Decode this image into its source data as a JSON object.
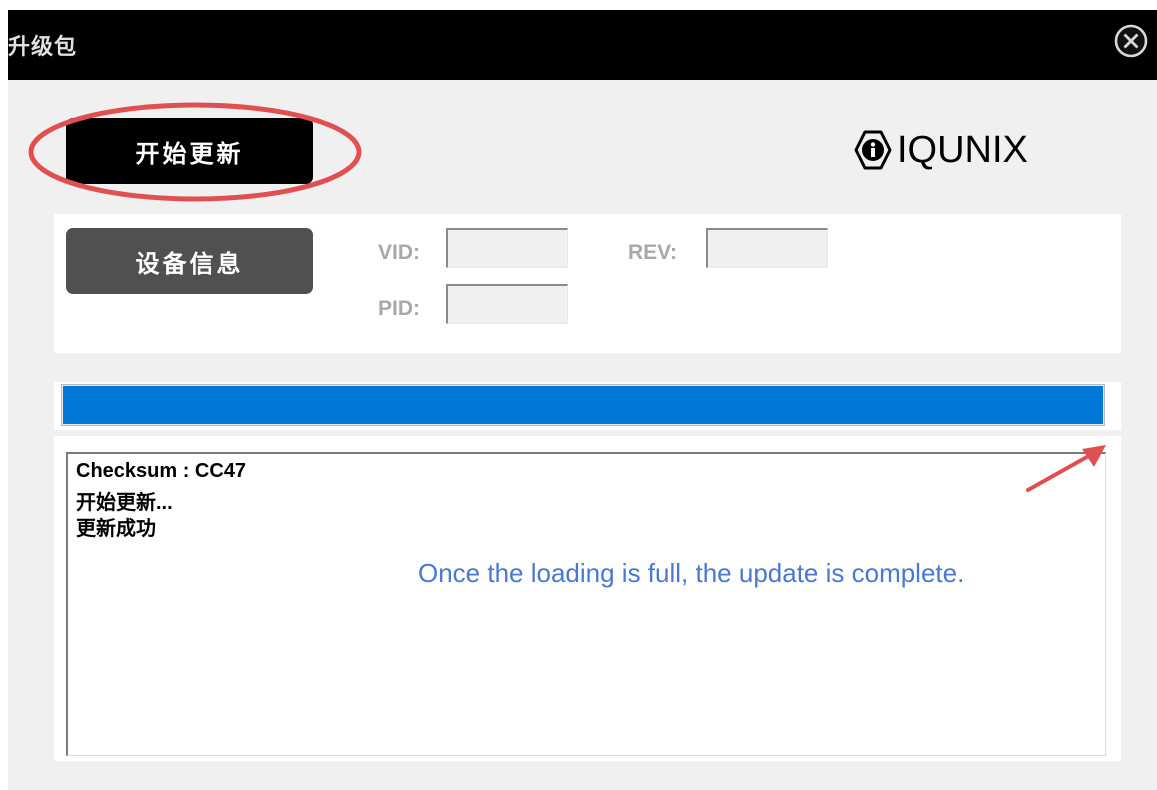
{
  "window": {
    "title": "升级包",
    "close_icon": "close-circle-icon"
  },
  "actions": {
    "start_update_label": "开始更新",
    "device_info_label": "设备信息"
  },
  "brand": {
    "logo_icon": "info-circle-logo-icon",
    "logo_text": "IQUNIX"
  },
  "device_fields": {
    "vid_label": "VID:",
    "vid_value": "",
    "pid_label": "PID:",
    "pid_value": "",
    "rev_label": "REV:",
    "rev_value": ""
  },
  "progress": {
    "fraction": 1.0,
    "color": "#0078d7"
  },
  "log": {
    "lines": [
      "Checksum : CC47",
      "开始更新...",
      "更新成功"
    ]
  },
  "annotations": {
    "note": "Once the loading is full, the update is complete.",
    "highlight_color": "#e05050"
  }
}
